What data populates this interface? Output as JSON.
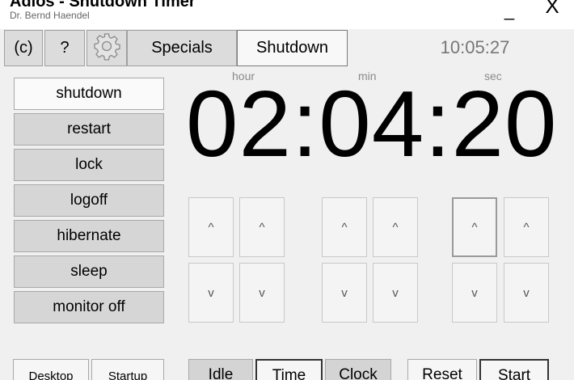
{
  "window": {
    "title": "Adios - Shutdown Timer",
    "author": "Dr. Bernd Haendel",
    "minimize_label": "_",
    "close_label": "X"
  },
  "toolbar": {
    "copyright_label": "(c)",
    "help_label": "?",
    "settings_icon": "gear-icon",
    "specials_label": "Specials",
    "shutdown_tab_label": "Shutdown",
    "clock": "10:05:27"
  },
  "actions": [
    {
      "label": "shutdown",
      "selected": true
    },
    {
      "label": "restart",
      "selected": false
    },
    {
      "label": "lock",
      "selected": false
    },
    {
      "label": "logoff",
      "selected": false
    },
    {
      "label": "hibernate",
      "selected": false
    },
    {
      "label": "sleep",
      "selected": false
    },
    {
      "label": "monitor off",
      "selected": false
    }
  ],
  "timer": {
    "labels": {
      "hour": "hour",
      "min": "min",
      "sec": "sec"
    },
    "display": "02:04:20",
    "up_symbol": "^",
    "down_symbol": "v"
  },
  "bottom": {
    "desktop_label": "Desktop",
    "startup_label": "Startup",
    "idle_label": "Idle",
    "time_label": "Time",
    "clock_label": "Clock",
    "reset_label": "Reset",
    "start_label": "Start"
  }
}
